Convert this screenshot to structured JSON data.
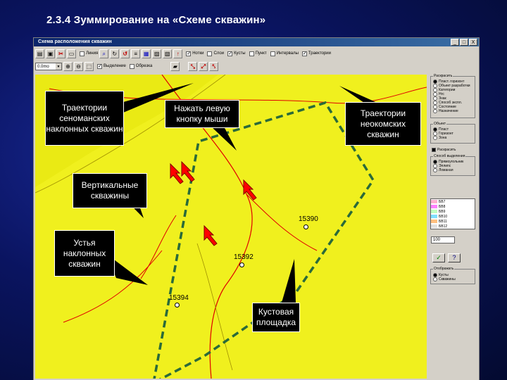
{
  "slide": {
    "title": "2.3.4 Зуммирование на «Схеме скважин»"
  },
  "window": {
    "title": "Схема расположения скважин",
    "btn_min": "_",
    "btn_max": "□",
    "btn_close": "X"
  },
  "toolbar1": {
    "checks": [
      {
        "label": "Нотки",
        "checked": true
      },
      {
        "label": "Слои",
        "checked": false
      },
      {
        "label": "Кусты",
        "checked": true
      },
      {
        "label": "Пункт",
        "checked": false
      },
      {
        "label": "Интервалы",
        "checked": false
      },
      {
        "label": "Траектории",
        "checked": true
      }
    ],
    "first_check": {
      "label": "Линия",
      "checked": false
    }
  },
  "toolbar2": {
    "color_combo": "0.0mo",
    "checks": [
      {
        "label": "Выделение",
        "checked": true
      },
      {
        "label": "Обрезка",
        "checked": false
      }
    ]
  },
  "panel": {
    "group1_title": "Раскрасить",
    "group1_options": [
      "Пласт. горизонт",
      "Объект разработки",
      "Категории",
      "Нгс",
      "Знак",
      "Способ экспл.",
      "Состояние",
      "Назначение"
    ],
    "group2_title": "Объект",
    "group2_options": [
      "Пласт",
      "Горизонт",
      "Зона"
    ],
    "check_label": "Раскрасить",
    "group3_title": "Способ выделения",
    "group3_options": [
      "Прямоугольник",
      "Эллипс",
      "Ломаная"
    ],
    "legend": [
      {
        "label": "БВ7",
        "color": "#ffb0d0"
      },
      {
        "label": "БВ8",
        "color": "#ff80ff"
      },
      {
        "label": "БВ9",
        "color": "#c0ffc0"
      },
      {
        "label": "БВ10",
        "color": "#80e0ff"
      },
      {
        "label": "БВ11",
        "color": "#ffc080"
      },
      {
        "label": "БВ12",
        "color": "#e0e0e0"
      }
    ],
    "count_value": "100",
    "group4_title": "Отображать",
    "group4_options": [
      "Кусты",
      "Скважины"
    ]
  },
  "map": {
    "colors": {
      "background": "#f0f01e",
      "dark_region": "#e8e800",
      "line": "#e00000",
      "dash": "#2a6a3a"
    },
    "wells": [
      {
        "label": "15390"
      },
      {
        "label": "15392"
      },
      {
        "label": "15394"
      }
    ]
  },
  "callouts": {
    "cenoman": "Траектории сеноманских наклонных скважин",
    "click": "Нажать левую кнопку мыши",
    "neokom": "Траектории неокомских скважин",
    "vertical": "Вертикальные скважины",
    "heads": "Устья наклонных скважин",
    "pad": "Кустовая площадка"
  }
}
